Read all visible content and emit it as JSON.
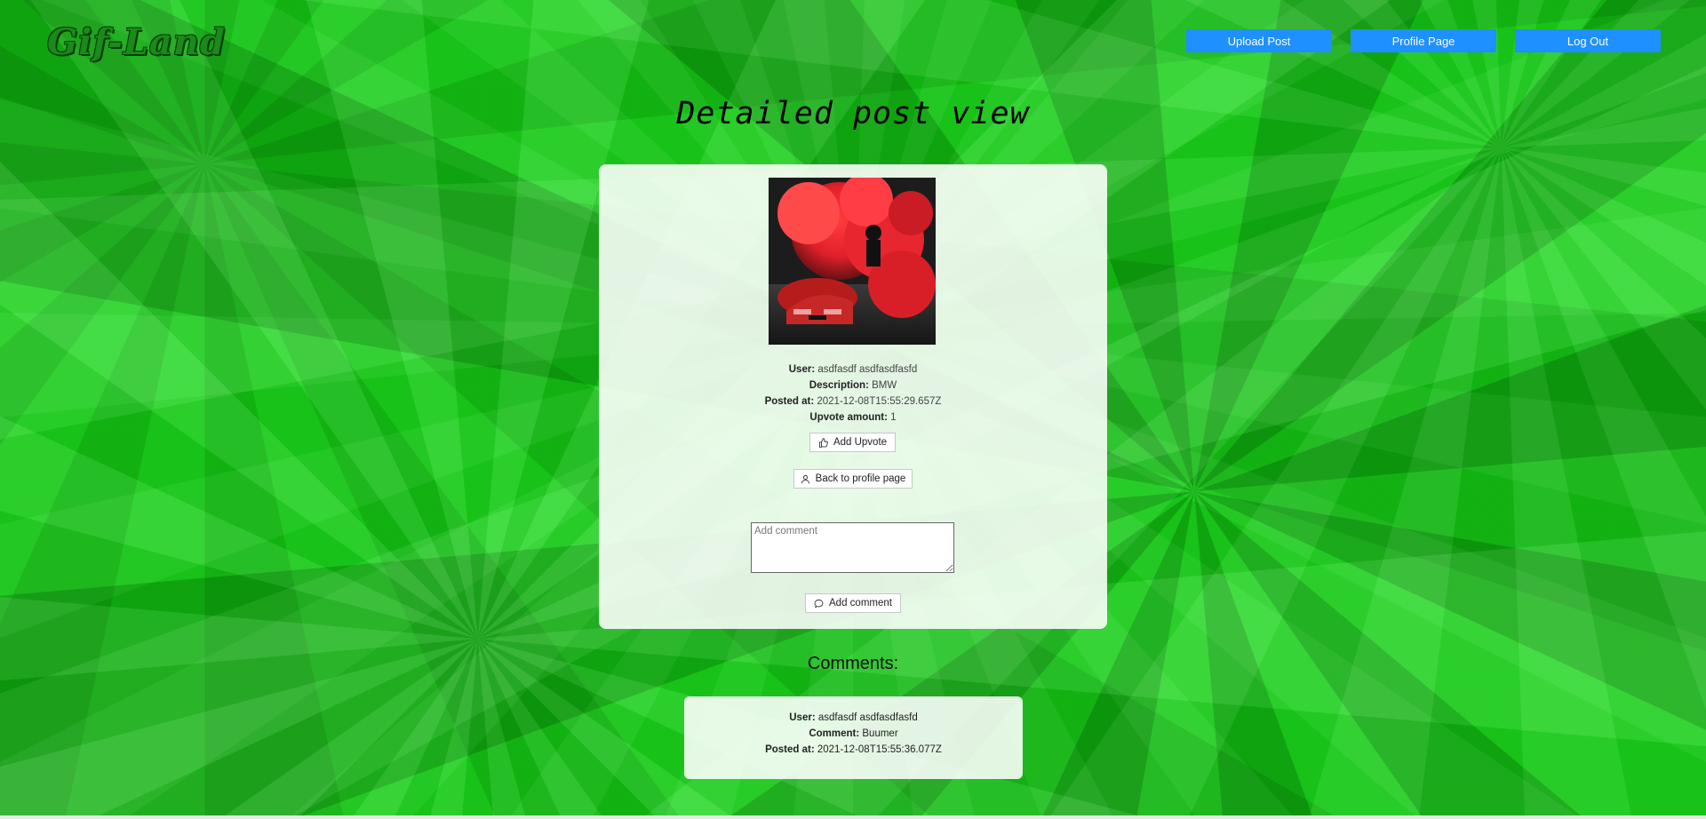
{
  "app": {
    "logo": "Gif-Land"
  },
  "nav": {
    "upload_post": "Upload Post",
    "profile_page": "Profile Page",
    "log_out": "Log Out"
  },
  "page": {
    "title": "Detailed post view"
  },
  "post": {
    "user_label": "User:",
    "user_value": "asdfasdf asdfasdfasfd",
    "description_label": "Description:",
    "description_value": "BMW",
    "posted_label": "Posted at:",
    "posted_value": "2021-12-08T15:55:29.657Z",
    "upvote_label": "Upvote amount:",
    "upvote_value": "1",
    "image_icon": "car-smoke-image"
  },
  "actions": {
    "add_upvote": "Add Upvote",
    "back_to_profile": "Back to profile page",
    "comment_placeholder": "Add comment",
    "add_comment": "Add comment"
  },
  "comments": {
    "heading": "Comments:",
    "items": [
      {
        "user_label": "User:",
        "user_value": "asdfasdf asdfasdfasfd",
        "comment_label": "Comment:",
        "comment_value": "Buumer",
        "posted_label": "Posted at:",
        "posted_value": "2021-12-08T15:55:36.077Z"
      }
    ]
  },
  "colors": {
    "accent": "#1e90ff",
    "background": "#62e062",
    "logo": "#1a8a1a"
  }
}
